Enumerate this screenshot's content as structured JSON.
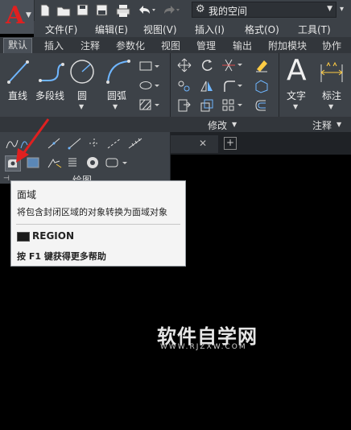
{
  "toolbar": {
    "workspace": "我的空间"
  },
  "menubar": {
    "items": [
      "文件(F)",
      "编辑(E)",
      "视图(V)",
      "插入(I)",
      "格式(O)",
      "工具(T)"
    ]
  },
  "ribbon": {
    "tabs": [
      "默认",
      "插入",
      "注释",
      "参数化",
      "视图",
      "管理",
      "输出",
      "附加模块",
      "协作"
    ],
    "draw": {
      "line": "直线",
      "polyline": "多段线",
      "circle": "圆",
      "arc": "圆弧",
      "title": "绘图"
    },
    "modify_title": "修改",
    "annotation": {
      "text": "文字",
      "dimension": "标注",
      "title": "注释"
    }
  },
  "tooltip": {
    "title": "面域",
    "description": "将包含封闭区域的对象转换为面域对象",
    "command": "REGION",
    "help": "按 F1 键获得更多帮助"
  },
  "watermark": {
    "title": "软件自学网",
    "url": "WWW.RJZXW.COM"
  },
  "colors": {
    "accent_red": "#e02020",
    "ribbon_bg": "#3d4248",
    "canvas_bg": "#000000"
  }
}
